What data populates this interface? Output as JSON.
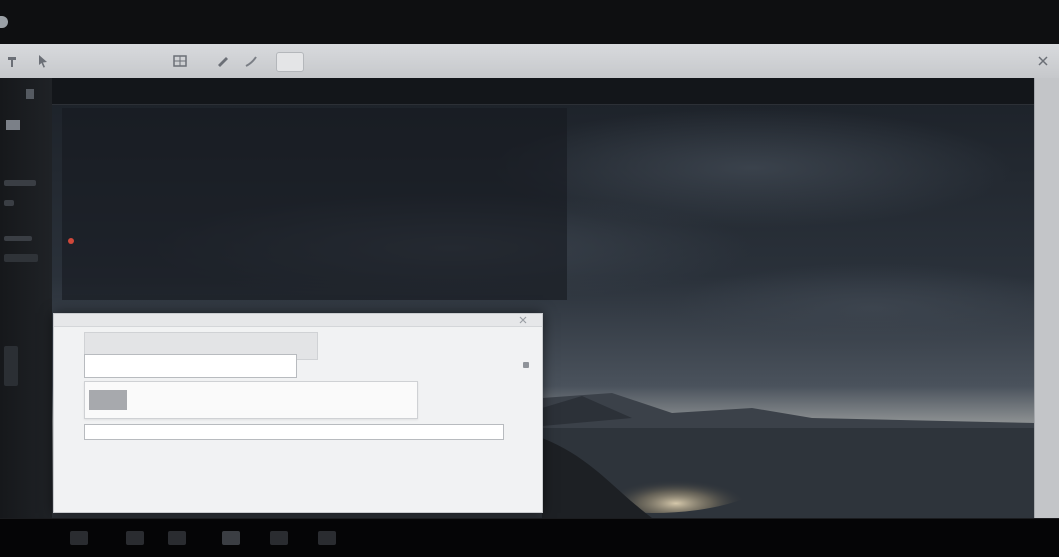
{
  "window": {
    "title": "",
    "menu": [
      "",
      "",
      ""
    ]
  },
  "toolbar": {
    "label": "",
    "right_text": "",
    "buttons": [
      {
        "icon": "pin-icon"
      },
      {
        "icon": "cursor-icon"
      },
      {
        "icon": "grid-icon"
      },
      {
        "icon": "brush-icon"
      },
      {
        "icon": "pencil-icon"
      }
    ]
  },
  "scene_header": {
    "breadcrumb": "",
    "tools": ""
  },
  "info_panel": {
    "title": "",
    "subtitle": "",
    "description": "",
    "status": "",
    "status_color": "#d0483a"
  },
  "dialog": {
    "heading": "",
    "field_text": "",
    "card": {
      "title": "",
      "subtitle": "",
      "action": ""
    },
    "input_value": "",
    "lines": [
      "",
      ""
    ]
  },
  "colors": {
    "titlebar": "#0e0f11",
    "toolbar": "#d8dadd",
    "panel": "#161a20",
    "dialog": "#f1f2f3",
    "accent_red": "#d0483a"
  }
}
